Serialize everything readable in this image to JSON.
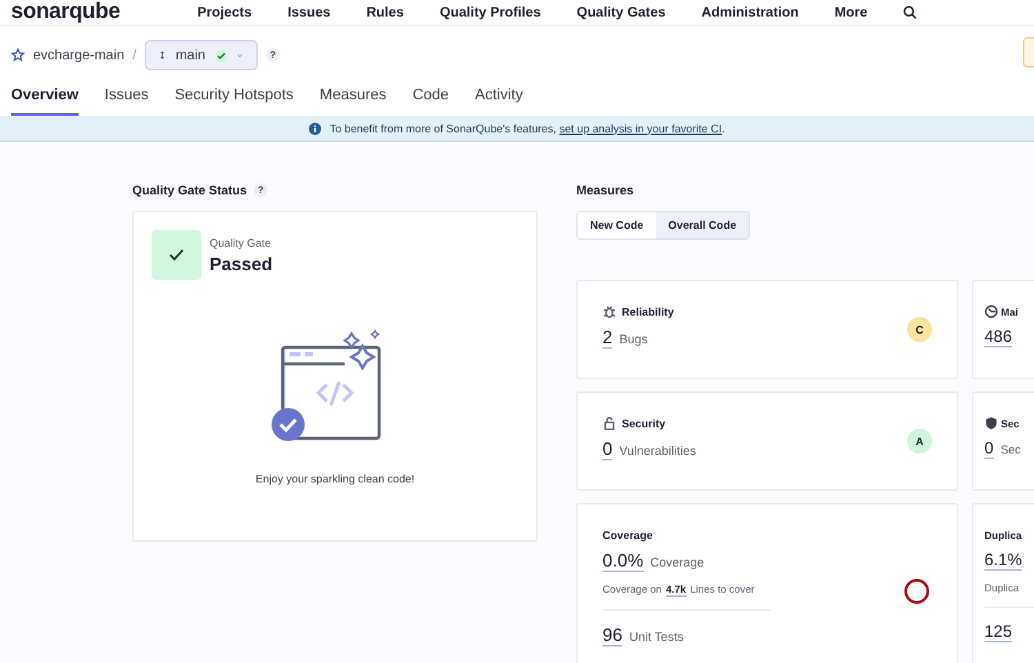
{
  "nav": {
    "logo": "sonarqube",
    "items": [
      "Projects",
      "Issues",
      "Rules",
      "Quality Profiles",
      "Quality Gates",
      "Administration",
      "More"
    ]
  },
  "breadcrumb": {
    "project": "evcharge-main",
    "separator": "/",
    "branch": "main",
    "branch_passed": true,
    "help": "?"
  },
  "tabs": [
    {
      "label": "Overview",
      "selected": true
    },
    {
      "label": "Issues",
      "selected": false
    },
    {
      "label": "Security Hotspots",
      "selected": false
    },
    {
      "label": "Measures",
      "selected": false
    },
    {
      "label": "Code",
      "selected": false
    },
    {
      "label": "Activity",
      "selected": false
    }
  ],
  "banner": {
    "text": "To benefit from more of SonarQube's features,",
    "link": "set up analysis in your favorite CI",
    "end": "."
  },
  "quality_gate": {
    "heading": "Quality Gate Status",
    "help": "?",
    "label": "Quality Gate",
    "status": "Passed",
    "passed": true,
    "message": "Enjoy your sparkling clean code!"
  },
  "measures": {
    "heading": "Measures",
    "toggle": [
      {
        "label": "New Code",
        "selected": false
      },
      {
        "label": "Overall Code",
        "selected": true
      }
    ],
    "cards": [
      {
        "kind": "rating",
        "title": "Reliability",
        "value": "2",
        "unit": "Bugs",
        "rating": "C",
        "color": "#fbe39c"
      },
      {
        "kind": "rating",
        "title": "Mai",
        "value": "486"
      },
      {
        "kind": "rating",
        "title": "Security",
        "value": "0",
        "unit": "Vulnerabilities",
        "rating": "A",
        "color": "#cff5dc"
      },
      {
        "kind": "rating",
        "title": "Sec",
        "value": "0",
        "unit": "Sec"
      },
      {
        "kind": "coverage",
        "title": "Coverage",
        "value": "0.0%",
        "unit": "Coverage",
        "sub_prefix": "Coverage on",
        "sub_value": "4.7k",
        "sub_unit": "Lines to cover",
        "tests_value": "96",
        "tests_unit": "Unit Tests",
        "level": 0
      },
      {
        "kind": "coverage",
        "title": "Duplica",
        "value": "6.1%",
        "sub_prefix": "Duplica",
        "tests_value": "125"
      }
    ]
  }
}
